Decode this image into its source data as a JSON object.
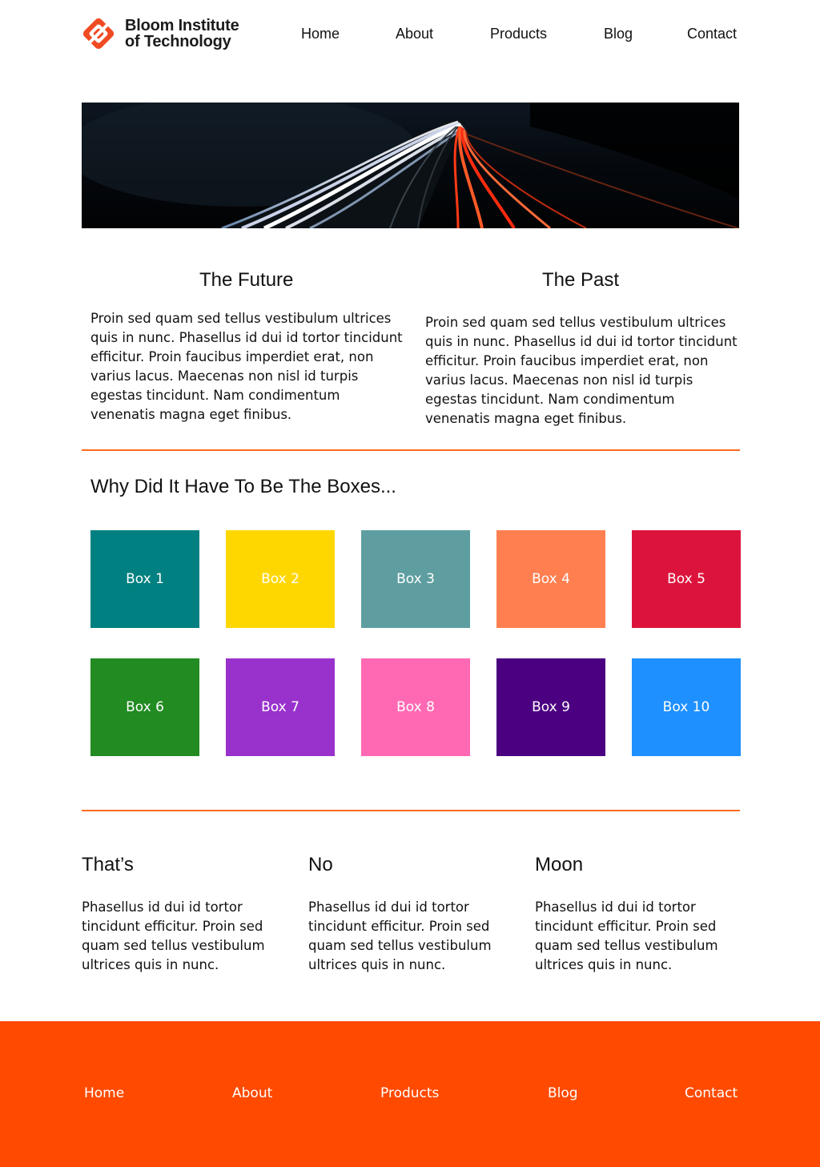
{
  "brand": {
    "name_line1": "Bloom Institute",
    "name_line2": "of Technology",
    "logo_icon": "bloom-logo-icon",
    "logo_color": "#f04a22"
  },
  "nav": [
    "Home",
    "About",
    "Products",
    "Blog",
    "Contact"
  ],
  "hero": {
    "image": "night highway light trails"
  },
  "columns": [
    {
      "title": "The Future",
      "body": "Proin sed quam sed tellus vestibulum ultrices quis in nunc. Phasellus id dui id tortor tincidunt efficitur. Proin faucibus imperdiet erat, non varius lacus. Maecenas non nisl id turpis egestas tincidunt. Nam condimentum venenatis magna eget finibus."
    },
    {
      "title": "The Past",
      "body": "Proin sed quam sed tellus vestibulum ultrices quis in nunc. Phasellus id dui id tortor tincidunt efficitur. Proin faucibus imperdiet erat, non varius lacus. Maecenas non nisl id turpis egestas tincidunt. Nam condimentum venenatis magna eget finibus."
    }
  ],
  "boxes_section": {
    "title": "Why Did It Have To Be The Boxes...",
    "boxes": [
      {
        "label": "Box 1",
        "color": "#008080"
      },
      {
        "label": "Box 2",
        "color": "#ffd700"
      },
      {
        "label": "Box 3",
        "color": "#5f9ea0"
      },
      {
        "label": "Box 4",
        "color": "#ff7f50"
      },
      {
        "label": "Box 5",
        "color": "#dc143c"
      },
      {
        "label": "Box 6",
        "color": "#228b22"
      },
      {
        "label": "Box 7",
        "color": "#9932cc"
      },
      {
        "label": "Box 8",
        "color": "#ff69b4"
      },
      {
        "label": "Box 9",
        "color": "#4b0082"
      },
      {
        "label": "Box 10",
        "color": "#1e90ff"
      }
    ]
  },
  "trio": [
    {
      "title": "That’s",
      "body": "Phasellus id dui id tortor tincidunt efficitur. Proin sed quam sed tellus vestibulum ultrices quis in nunc."
    },
    {
      "title": "No",
      "body": "Phasellus id dui id tortor tincidunt efficitur. Proin sed quam sed tellus vestibulum ultrices quis in nunc."
    },
    {
      "title": "Moon",
      "body": "Phasellus id dui id tortor tincidunt efficitur. Proin sed quam sed tellus vestibulum ultrices quis in nunc."
    }
  ],
  "footer_nav": [
    "Home",
    "About",
    "Products",
    "Blog",
    "Contact"
  ],
  "colors": {
    "accent": "#ff6a1f",
    "footer": "#ff4a00"
  }
}
